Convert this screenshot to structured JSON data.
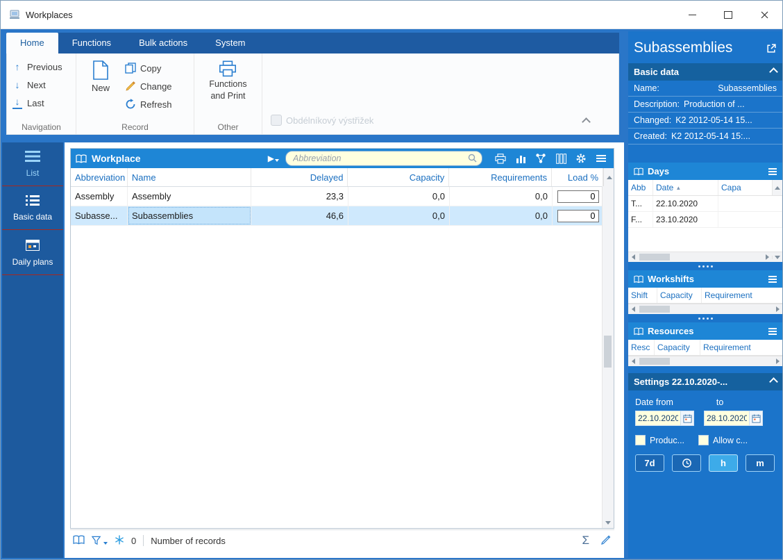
{
  "window": {
    "title": "Workplaces"
  },
  "ribbon": {
    "tabs": [
      "Home",
      "Functions",
      "Bulk actions",
      "System"
    ],
    "navigation": {
      "group_label": "Navigation",
      "previous": "Previous",
      "next": "Next",
      "last": "Last"
    },
    "record": {
      "group_label": "Record",
      "new": "New",
      "copy": "Copy",
      "change": "Change",
      "refresh": "Refresh"
    },
    "other": {
      "group_label": "Other",
      "functions_print_1": "Functions",
      "functions_print_2": "and Print"
    },
    "watermark": "Obdélníkový výstřižek"
  },
  "sidebar": {
    "items": [
      {
        "label": "List",
        "active": true
      },
      {
        "label": "Basic data",
        "active": false
      },
      {
        "label": "Daily plans",
        "active": false
      }
    ]
  },
  "grid": {
    "title": "Workplace",
    "search_placeholder": "Abbreviation",
    "columns": [
      "Abbreviation",
      "Name",
      "Delayed",
      "Capacity",
      "Requirements",
      "Load %"
    ],
    "rows": [
      {
        "abbreviation": "Assembly",
        "name": "Assembly",
        "delayed": "23,3",
        "capacity": "0,0",
        "requirements": "0,0",
        "load": "0",
        "selected": false
      },
      {
        "abbreviation": "Subasse...",
        "name": "Subassemblies",
        "delayed": "46,6",
        "capacity": "0,0",
        "requirements": "0,0",
        "load": "0",
        "selected": true
      }
    ],
    "status": {
      "count": "0",
      "label": "Number of records"
    }
  },
  "panel": {
    "title": "Subassemblies",
    "basic_data": {
      "header": "Basic data",
      "name_label": "Name:",
      "name_value": "Subassemblies",
      "description_label": "Description:",
      "description_value": "Production of ...",
      "changed_label": "Changed:",
      "changed_value": "K2 2012-05-14 15...",
      "created_label": "Created:",
      "created_value": "K2 2012-05-14 15:..."
    },
    "days": {
      "header": "Days",
      "columns": [
        "Abb",
        "Date",
        "Capa"
      ],
      "rows": [
        {
          "abb": "T...",
          "date": "22.10.2020"
        },
        {
          "abb": "F...",
          "date": "23.10.2020"
        }
      ]
    },
    "workshifts": {
      "header": "Workshifts",
      "columns": [
        "Shift",
        "Capacity",
        "Requirement"
      ]
    },
    "resources": {
      "header": "Resources",
      "columns": [
        "Resc",
        "Capacity",
        "Requirement"
      ]
    },
    "settings": {
      "header": "Settings 22.10.2020-...",
      "date_from_label": "Date from",
      "date_to_label": "to",
      "date_from_value": "22.10.2020",
      "date_to_value": "28.10.2020",
      "checkbox_1": "Produc...",
      "checkbox_2": "Allow c...",
      "button_7d": "7d",
      "button_h": "h",
      "button_m": "m"
    }
  },
  "icons": {
    "previous": "↑",
    "next": "↓",
    "last": "↓",
    "play": "▶",
    "sort_asc": "▲",
    "sigma": "Σ"
  },
  "colors": {
    "accent_blue": "#1e86d6",
    "dark_blue": "#1d5a9e",
    "panel_blue": "#1b74ca",
    "selected_row": "#cfe9fd",
    "input_yellow": "#ffffdf",
    "sidebar_separator_red": "#a8281e",
    "active_button": "#3dabe9"
  }
}
